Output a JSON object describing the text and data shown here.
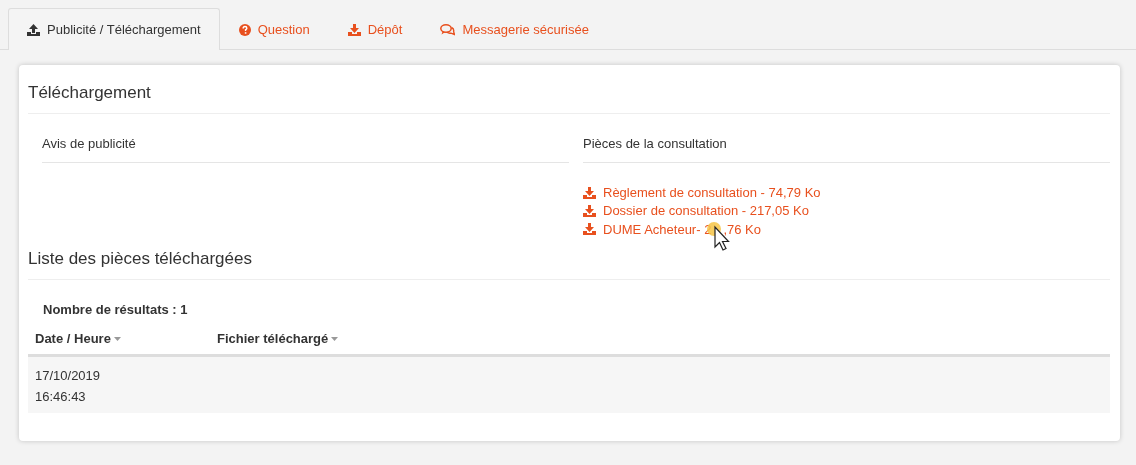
{
  "tabs": [
    {
      "label": "Publicité / Téléchargement",
      "selected": true
    },
    {
      "label": "Question",
      "selected": false
    },
    {
      "label": "Dépôt",
      "selected": false
    },
    {
      "label": "Messagerie sécurisée",
      "selected": false
    }
  ],
  "download_section": {
    "title": "Téléchargement",
    "left_heading": "Avis de publicité",
    "right_heading": "Pièces de la consultation",
    "files": [
      {
        "label": "Règlement de consultation - 74,79 Ko"
      },
      {
        "label": "Dossier de consultation - 217,05 Ko"
      },
      {
        "label": "DUME Acheteur- 2",
        "label_after_cursor": ",76 Ko"
      }
    ]
  },
  "downloads_list": {
    "title": "Liste des pièces téléchargées",
    "result_count": "Nombre de résultats : 1",
    "columns": [
      "Date / Heure",
      "Fichier téléchargé"
    ],
    "rows": [
      {
        "date": "17/10/2019",
        "time": "16:46:43"
      }
    ]
  }
}
